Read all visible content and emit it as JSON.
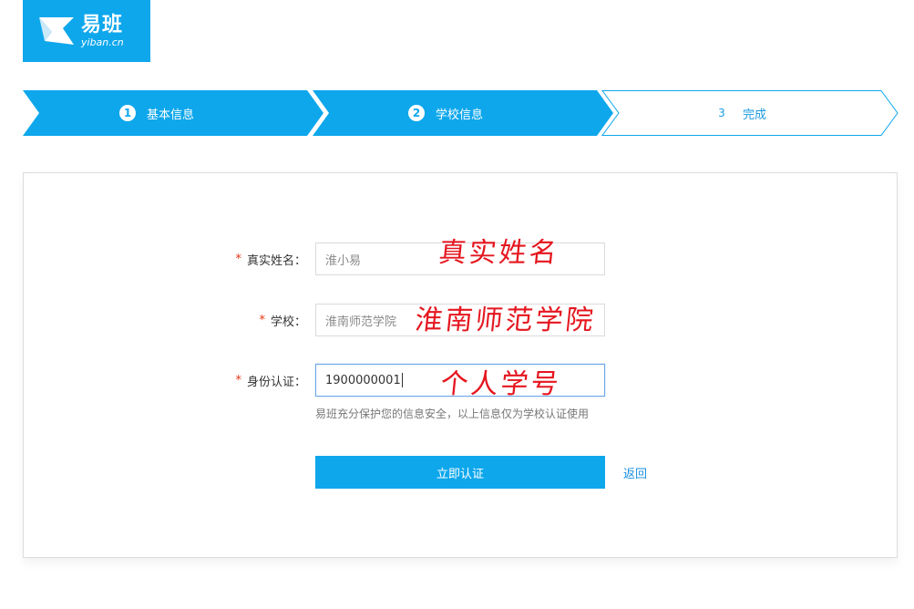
{
  "logo": {
    "name_cn": "易班",
    "name_en": "yiban.cn"
  },
  "steps": [
    {
      "number": "1",
      "label": "基本信息",
      "state": "done"
    },
    {
      "number": "2",
      "label": "学校信息",
      "state": "current"
    },
    {
      "number": "3",
      "label": "完成",
      "state": "pending"
    }
  ],
  "form": {
    "required_mark": "*",
    "name": {
      "label": "真实姓名：",
      "value": "淮小易",
      "annotation": "真实姓名"
    },
    "school": {
      "label": "学校：",
      "value": "淮南师范学院",
      "annotation": "淮南师范学院"
    },
    "id": {
      "label": "身份认证：",
      "value": "1900000001",
      "annotation": "个人学号"
    },
    "hint": "易班充分保护您的信息安全，以上信息仅为学校认证使用",
    "submit_label": "立即认证",
    "back_label": "返回"
  },
  "colors": {
    "accent": "#0ea7ec",
    "required": "#e8340f",
    "annotation": "#e5161f",
    "link": "#1a8fe0"
  }
}
